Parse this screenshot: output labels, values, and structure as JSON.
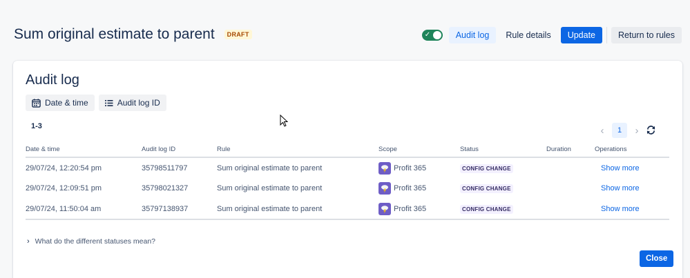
{
  "header": {
    "title": "Sum original estimate to parent",
    "badge": "DRAFT",
    "toggle_on": true,
    "buttons": {
      "audit_log": "Audit log",
      "rule_details": "Rule details",
      "update": "Update",
      "return_to_rules": "Return to rules"
    }
  },
  "card": {
    "title": "Audit log",
    "filters": [
      {
        "label": "Date & time",
        "icon": "calendar-icon"
      },
      {
        "label": "Audit log ID",
        "icon": "list-icon"
      }
    ],
    "count": "1-3",
    "pagination": {
      "current_page": "1",
      "prev": "‹",
      "next": "›"
    },
    "table": {
      "columns": [
        "Date & time",
        "Audit log ID",
        "Rule",
        "Scope",
        "Status",
        "Duration",
        "Operations"
      ],
      "rows": [
        {
          "datetime": "29/07/24, 12:20:54 pm",
          "id": "35798511797",
          "rule": "Sum original estimate to parent",
          "scope": "Profit 365",
          "status": "CONFIG CHANGE",
          "duration": "",
          "operation": "Show more"
        },
        {
          "datetime": "29/07/24, 12:09:51 pm",
          "id": "35798021327",
          "rule": "Sum original estimate to parent",
          "scope": "Profit 365",
          "status": "CONFIG CHANGE",
          "duration": "",
          "operation": "Show more"
        },
        {
          "datetime": "29/07/24, 11:50:04 am",
          "id": "35797138937",
          "rule": "Sum original estimate to parent",
          "scope": "Profit 365",
          "status": "CONFIG CHANGE",
          "duration": "",
          "operation": "Show more"
        }
      ]
    },
    "disclosure": "What do the different statuses mean?",
    "close_label": "Close"
  },
  "colors": {
    "primary": "#0c66e4",
    "toggle": "#1f845a",
    "draft_bg": "#fff7d6",
    "draft_text": "#a54800",
    "lozenge_bg": "#f3f0ff",
    "scope_icon": "#6e5dc6"
  }
}
